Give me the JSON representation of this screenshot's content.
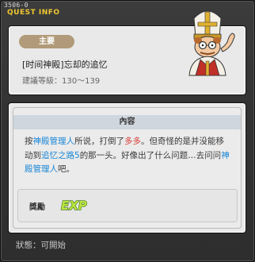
{
  "window": {
    "id": "3506-0",
    "title": "QUEST INFO"
  },
  "quest": {
    "tag": "主要",
    "name": "[时间神殿]忘却的追忆",
    "level": "建議等級：130～139"
  },
  "content": {
    "header": "內容",
    "description": [
      {
        "text": "按",
        "style": "plain"
      },
      {
        "text": "神殿管理人",
        "style": "blue"
      },
      {
        "text": "所说，打倒了",
        "style": "plain"
      },
      {
        "text": "多多",
        "style": "red"
      },
      {
        "text": "。但奇怪的是并没能移动到",
        "style": "plain"
      },
      {
        "text": "追忆之路5",
        "style": "blue"
      },
      {
        "text": "的那一头。好像出了什么问题…去问问",
        "style": "plain"
      },
      {
        "text": "神殿管理人",
        "style": "blue"
      },
      {
        "text": "吧。",
        "style": "plain"
      }
    ]
  },
  "reward": {
    "label": "獎勵",
    "exp_label": "EXP"
  },
  "status": "狀態：可開始",
  "colors": {
    "title_yellow": "#f0c830",
    "npc_blue": "#1a86d6",
    "mob_red": "#d8443c",
    "tag_tan": "#b19a79"
  }
}
